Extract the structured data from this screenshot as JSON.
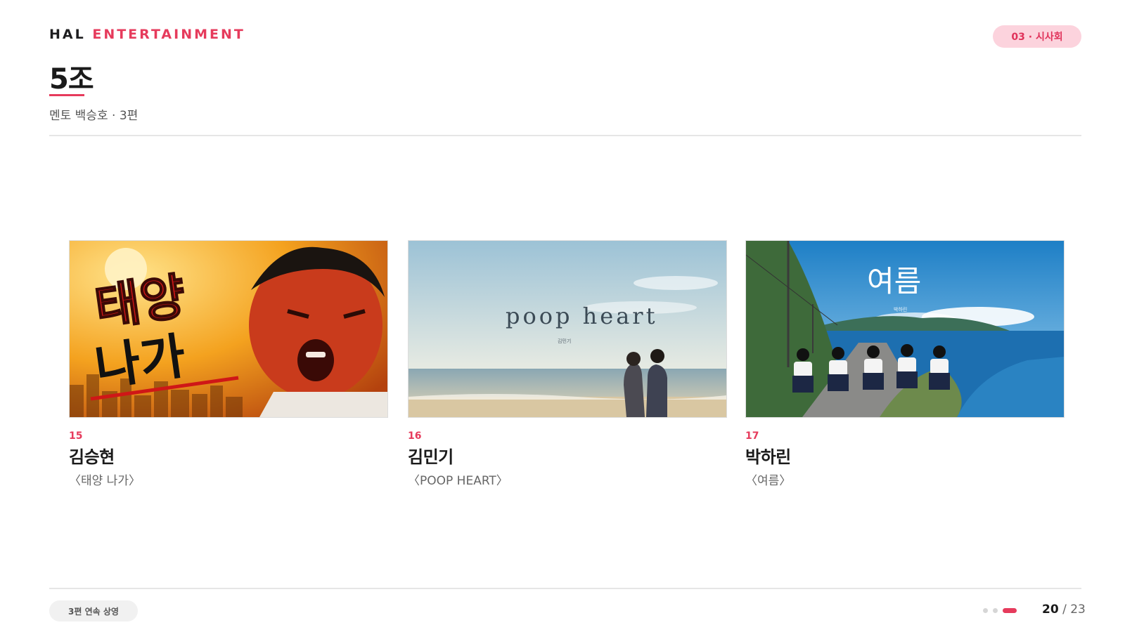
{
  "header": {
    "brand_prefix": "HAL",
    "brand_accent": "ENTERTAINMENT",
    "section_badge": "03 · 시사회",
    "group_title": "5조",
    "subtitle": "멘토 백승호 · 3편"
  },
  "films": [
    {
      "number": "15",
      "director": "김승현",
      "title": "〈태양 나가〉",
      "poster_text": "태양\n나가",
      "poster_line1": "태양",
      "poster_line2": "나가"
    },
    {
      "number": "16",
      "director": "김민기",
      "title": "〈POOP HEART〉",
      "poster_text": "poop heart",
      "poster_credit": "김민기"
    },
    {
      "number": "17",
      "director": "박하린",
      "title": "〈여름〉",
      "poster_text": "여름",
      "poster_credit": "박하린"
    }
  ],
  "footer": {
    "badge": "3편 연속 상영",
    "page_current": "20",
    "page_separator": "/",
    "page_total": "23",
    "dots_total": 3,
    "dots_active_index": 2
  },
  "colors": {
    "accent": "#e63b5c",
    "badge_bg": "#fcd3dd"
  }
}
